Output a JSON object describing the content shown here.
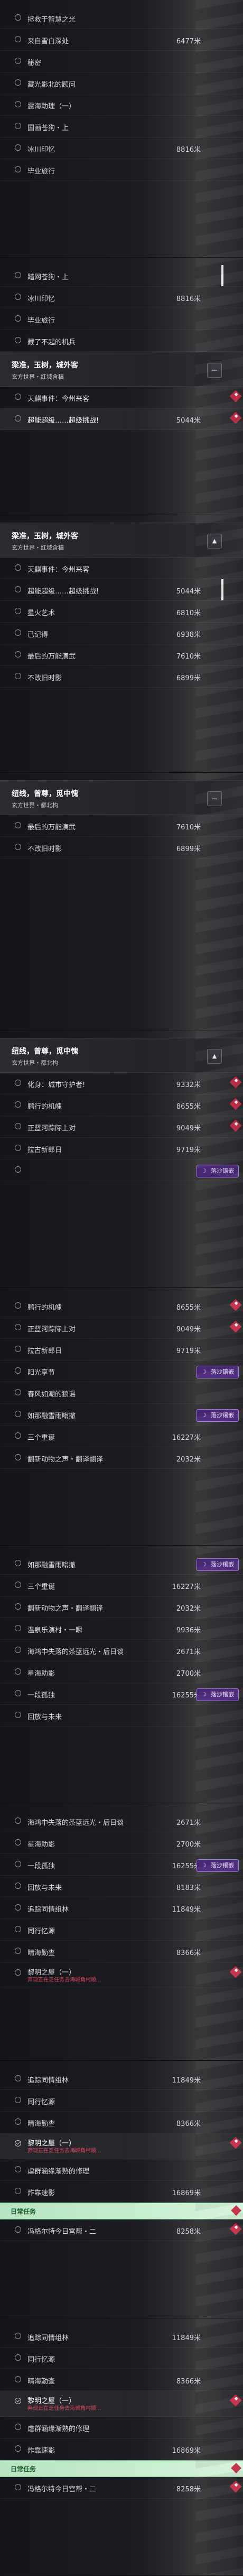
{
  "panels": [
    {
      "rows": [
        {
          "name": "拯救于智慧之光",
          "dist": "",
          "done": false,
          "side": false
        },
        {
          "name": "来自雪白深处",
          "dist": "6477米",
          "done": false,
          "side": false
        },
        {
          "name": "秘密",
          "dist": "",
          "done": false,
          "side": false
        },
        {
          "name": "藏光影北的顾问",
          "dist": "",
          "done": false,
          "side": false
        },
        {
          "name": "震海助理（一）",
          "dist": "",
          "done": false,
          "side": false
        },
        {
          "name": "国画苍狗・上",
          "dist": "",
          "done": false,
          "side": false
        },
        {
          "name": "冰川印忆",
          "dist": "8816米",
          "done": false,
          "side": false
        },
        {
          "name": "毕业旅行",
          "dist": "",
          "done": false,
          "side": false
        }
      ]
    },
    {
      "rows": [
        {
          "name": "踏网苍狗・上",
          "dist": "",
          "done": false,
          "side": true
        },
        {
          "name": "冰川印忆",
          "dist": "8816米",
          "done": false,
          "side": false
        },
        {
          "name": "毕业旅行",
          "dist": "",
          "done": false,
          "side": false
        },
        {
          "name": "藏了不起的机兵",
          "dist": "",
          "done": false,
          "side": false
        }
      ],
      "group": {
        "title": "梁准，玉树，城外客",
        "sub": "玄方世界・红域含稿",
        "btn": "—"
      },
      "after": [
        {
          "name": "天麒事件：今州来客",
          "dist": "",
          "done": false,
          "side": false,
          "pin": true
        },
        {
          "name": "超能超级……超级挑战!",
          "dist": "5044米",
          "done": false,
          "side": false,
          "hl": true,
          "pin": true
        }
      ]
    },
    {
      "group": {
        "title": "梁准，玉树，城外客",
        "sub": "玄方世界・红域含稿",
        "btn": "▲"
      },
      "rows": [
        {
          "name": "天麒事件：今州来客",
          "dist": "",
          "done": false,
          "side": false
        },
        {
          "name": "超能超级……超级挑战!",
          "dist": "5044米",
          "done": false,
          "side": true
        },
        {
          "name": "星火艺术",
          "dist": "6810米",
          "done": false,
          "side": false
        },
        {
          "name": "已记得",
          "dist": "6938米",
          "done": false,
          "side": false
        },
        {
          "name": "最后的万能演武",
          "dist": "7610米",
          "done": false,
          "side": false
        },
        {
          "name": "不改旧时影",
          "dist": "6899米",
          "done": false,
          "side": false
        }
      ]
    },
    {
      "group": {
        "title": "纽线，曾尊，觅中愧",
        "sub": "玄方世界・都北构",
        "btn": "—"
      },
      "rows": [
        {
          "name": "最后的万能演武",
          "dist": "7610米",
          "done": false,
          "side": false
        },
        {
          "name": "不改旧时影",
          "dist": "6899米",
          "done": false,
          "side": false
        }
      ]
    },
    {
      "group": {
        "title": "纽线，曾尊，觅中愧",
        "sub": "玄方世界・都北构",
        "btn": "▲"
      },
      "rows": [
        {
          "name": "化身：城市守护者!",
          "dist": "9332米",
          "done": false,
          "side": false,
          "pin": true
        },
        {
          "name": "鹏行的机魄",
          "dist": "8655米",
          "done": false,
          "side": false,
          "pin": true
        },
        {
          "name": "正蓝河踪际上对",
          "dist": "9049米",
          "done": false,
          "side": false,
          "pin": true
        },
        {
          "name": "拉古新郎日",
          "dist": "9719米",
          "done": false,
          "side": false
        },
        {
          "name": "",
          "dist": "",
          "done": false,
          "side": false,
          "badge": "落沙镶嵌"
        }
      ]
    },
    {
      "rows": [
        {
          "name": "鹏行的机魄",
          "dist": "8655米",
          "done": false,
          "side": false,
          "pin": true
        },
        {
          "name": "正蓝河踪际上对",
          "dist": "9049米",
          "done": false,
          "side": false,
          "pin": true
        },
        {
          "name": "拉古新郎日",
          "dist": "9719米",
          "done": false,
          "side": false
        },
        {
          "name": "阳光享节",
          "dist": "",
          "done": false,
          "side": false,
          "badge": "落沙镶嵌"
        },
        {
          "name": "春风如潮的狼谣",
          "dist": "",
          "done": false,
          "side": false
        },
        {
          "name": "如那融雪雨嗡撤",
          "dist": "",
          "done": false,
          "side": false,
          "badge": "落沙镶嵌"
        },
        {
          "name": "三个重诞",
          "dist": "16227米",
          "done": false,
          "side": false
        },
        {
          "name": "翻新动物之声・翻译翻译",
          "dist": "2032米",
          "done": false,
          "side": false
        }
      ]
    },
    {
      "rows": [
        {
          "name": "如那融雪雨嗡撤",
          "dist": "",
          "done": false,
          "side": false,
          "badge": "落沙镶嵌"
        },
        {
          "name": "三个重诞",
          "dist": "16227米",
          "done": false,
          "side": false
        },
        {
          "name": "翻新动物之声・翻译翻译",
          "dist": "2032米",
          "done": false,
          "side": false
        },
        {
          "name": "温泉乐演村・一瞬",
          "dist": "9936米",
          "done": false,
          "side": false
        },
        {
          "name": "海鸿中失落的茶蓝远光・后日谈",
          "dist": "2671米",
          "done": false,
          "side": false
        },
        {
          "name": "星海助影",
          "dist": "2700米",
          "done": false,
          "side": false
        },
        {
          "name": "一段孤独",
          "dist": "16255米",
          "done": false,
          "side": false,
          "badge": "落沙镶嵌"
        },
        {
          "name": "回放与未来",
          "dist": "",
          "done": false,
          "side": false
        }
      ]
    },
    {
      "rows": [
        {
          "name": "海鸿中失落的茶蓝远光・后日谈",
          "dist": "2671米",
          "done": false,
          "side": false
        },
        {
          "name": "星海助影",
          "dist": "2700米",
          "done": false,
          "side": false
        },
        {
          "name": "一段孤独",
          "dist": "16255米",
          "done": false,
          "side": false,
          "badge": "落沙镶嵌"
        },
        {
          "name": "回放与未来",
          "dist": "8183米",
          "done": false,
          "side": false
        },
        {
          "name": "追踪同情组林",
          "dist": "11849米",
          "done": false,
          "side": false
        },
        {
          "name": "同行忆源",
          "dist": "",
          "done": false,
          "side": false
        },
        {
          "name": "晴海勤查",
          "dist": "8366米",
          "done": false,
          "side": false
        },
        {
          "name": "黎明之屋（一）",
          "dist": "",
          "done": false,
          "side": false,
          "sub": "弃现正在乏任务去海城角村顺...",
          "pin": true
        }
      ]
    },
    {
      "rows": [
        {
          "name": "追踪同情组林",
          "dist": "11849米",
          "done": false,
          "side": false
        },
        {
          "name": "同行忆源",
          "dist": "",
          "done": false,
          "side": false
        },
        {
          "name": "晴海勤查",
          "dist": "8366米",
          "done": false,
          "side": false
        },
        {
          "name": "黎明之屋（一）",
          "dist": "",
          "done": true,
          "side": false,
          "sub": "弃现正在乏任务去海城角村顺...",
          "pin": true,
          "hl": true
        },
        {
          "name": "虐群涵缘渐熟的修理",
          "dist": "",
          "done": false,
          "side": false
        },
        {
          "name": "炸靠速影",
          "dist": "16869米",
          "done": false,
          "side": false
        }
      ],
      "daily": {
        "title": "日常任务"
      },
      "after": [
        {
          "name": "冯格尔特今日宫帮・二",
          "dist": "8258米",
          "done": false,
          "side": false,
          "pin": true
        }
      ]
    },
    {
      "rows": [
        {
          "name": "追踪同情组林",
          "dist": "11849米",
          "done": false,
          "side": false
        },
        {
          "name": "同行忆源",
          "dist": "",
          "done": false,
          "side": false
        },
        {
          "name": "晴海勤查",
          "dist": "8366米",
          "done": false,
          "side": false
        },
        {
          "name": "黎明之屋（一）",
          "dist": "",
          "done": true,
          "side": false,
          "sub": "弃现正在乏任务去海城角村顺...",
          "pin": true,
          "hl": true
        },
        {
          "name": "虐群涵缘渐熟的修理",
          "dist": "",
          "done": false,
          "side": false
        },
        {
          "name": "炸靠速影",
          "dist": "16869米",
          "done": false,
          "side": false
        }
      ],
      "daily": {
        "title": "日常任务"
      },
      "after": [
        {
          "name": "冯格尔特今日宫帮・二",
          "dist": "8258米",
          "done": false,
          "side": false,
          "pin": true
        }
      ]
    }
  ]
}
